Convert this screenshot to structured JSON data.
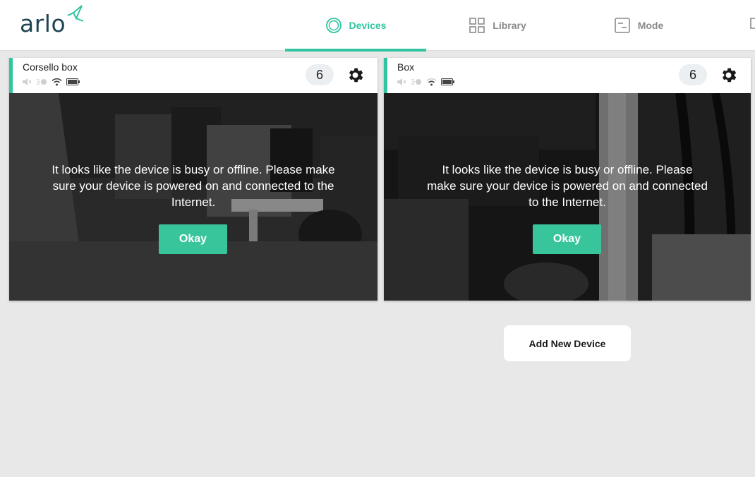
{
  "brand": {
    "logo_text": "arlo",
    "accent_color": "#30c4a0",
    "logo_color": "#1f4552"
  },
  "nav": {
    "tabs": [
      {
        "label": "Devices",
        "icon": "devices-icon",
        "active": true
      },
      {
        "label": "Library",
        "icon": "library-grid-icon",
        "active": false
      },
      {
        "label": "Mode",
        "icon": "mode-icon",
        "active": false
      }
    ]
  },
  "devices": [
    {
      "name": "Corsello box",
      "count": "6",
      "status_icons": [
        "speaker-muted-icon",
        "motion-icon",
        "wifi-icon",
        "battery-icon"
      ],
      "message": "It looks like the device is busy or offline. Please make sure your device is powered on and connected to the Internet.",
      "button_label": "Okay"
    },
    {
      "name": "Box",
      "count": "6",
      "status_icons": [
        "speaker-muted-icon",
        "motion-icon",
        "wifi-icon",
        "battery-icon"
      ],
      "message": "It looks like the device is busy or offline. Please make sure your device is powered on and connected to the Internet.",
      "button_label": "Okay"
    }
  ],
  "add_device_label": "Add New Device"
}
